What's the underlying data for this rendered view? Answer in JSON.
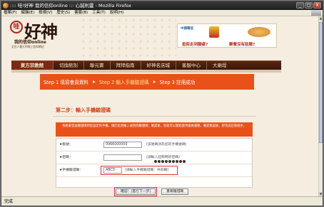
{
  "window": {
    "title": ":::: 哇!好神 我的信仰online ::: 心誠則靈 - Mozilla Firefox",
    "buttons": {
      "minimize": "_",
      "maximize": "□",
      "close": "X"
    }
  },
  "menubar": {
    "items": [
      "檔案(F)",
      "編輯(E)",
      "檢視(V)",
      "歷史(S)",
      "書籤(B)",
      "工具(T)",
      "說明(H)"
    ]
  },
  "site": {
    "logo_mark": "哇",
    "logo_text": "好神",
    "logo_sub": "我的信仰online",
    "logo_sub2": "全台人最大的線上信仰網站",
    "ad": {
      "brand": "中國電信",
      "text_left": "逛街走到腳痠?",
      "text_right": "聚餐沒有話題?"
    }
  },
  "nav": {
    "home": "東方宗教館",
    "items": [
      "切換館別",
      "聯元寶",
      "拜拜指南",
      "好神名店城",
      "客服中心",
      "大廟埕"
    ]
  },
  "steps": {
    "step1": "Step 1 填寫會員資料",
    "step2": "Step 2 輸入手機驗證碼",
    "step3": "Step 3 註冊成功",
    "arrow": "➤"
  },
  "form": {
    "heading": "第二步：輸入手機驗證碼",
    "notice": "系統會發送驗證碼到您設定的手機，請於此頁輸入收到的驗證碼；確認後，您就可以開始使用會員服務。確認無誤後，即完成註冊程序，",
    "phone_label": "★帳號：",
    "phone_value": "0966000000",
    "phone_hint": "(該號碼須為您的手機號碼)",
    "password_label": "★密碼：",
    "password_hint": "(請輸入註冊時的密碼)",
    "code_label": "★手機驗證碼：",
    "code_value": "ABCD",
    "code_hint": "(請輸入手機驗證碼：共四碼)",
    "confirm_button": "確認！(進行下一步)",
    "resend_button": "重寄驗證碼"
  },
  "statusbar": {
    "text": "完成"
  }
}
